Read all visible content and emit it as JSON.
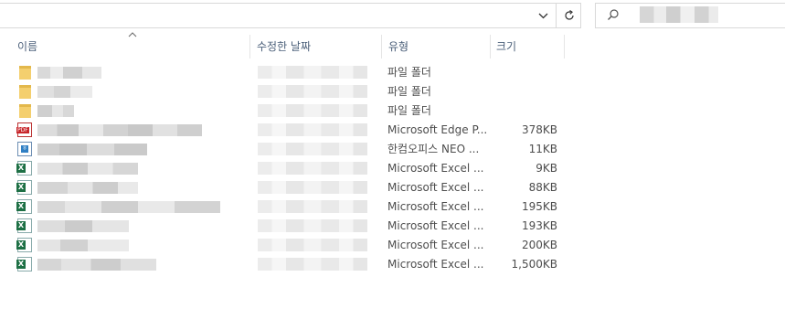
{
  "search": {
    "placeholder": ""
  },
  "header": {
    "name": "이름",
    "modified": "수정한 날짜",
    "type": "유형",
    "size": "크기"
  },
  "files": [
    {
      "icon": "folder-icon",
      "type": "파일 폴더",
      "size": ""
    },
    {
      "icon": "folder-icon",
      "type": "파일 폴더",
      "size": ""
    },
    {
      "icon": "folder-icon",
      "type": "파일 폴더",
      "size": ""
    },
    {
      "icon": "pdf-file-icon",
      "type": "Microsoft Edge P...",
      "size": "378KB"
    },
    {
      "icon": "hwp-file-icon",
      "type": "한컴오피스 NEO ...",
      "size": "11KB"
    },
    {
      "icon": "excel-file-icon",
      "type": "Microsoft Excel ...",
      "size": "9KB"
    },
    {
      "icon": "excel-file-icon",
      "type": "Microsoft Excel ...",
      "size": "88KB"
    },
    {
      "icon": "excel-file-icon",
      "type": "Microsoft Excel ...",
      "size": "195KB"
    },
    {
      "icon": "excel-file-icon",
      "type": "Microsoft Excel ...",
      "size": "193KB"
    },
    {
      "icon": "excel-file-icon",
      "type": "Microsoft Excel ...",
      "size": "200KB"
    },
    {
      "icon": "excel-file-icon",
      "type": "Microsoft Excel ...",
      "size": "1,500KB"
    }
  ],
  "icons": {
    "address_dropdown": "chevron-down-icon",
    "refresh": "refresh-icon",
    "search": "search-icon",
    "sort": "sort-up-icon"
  }
}
